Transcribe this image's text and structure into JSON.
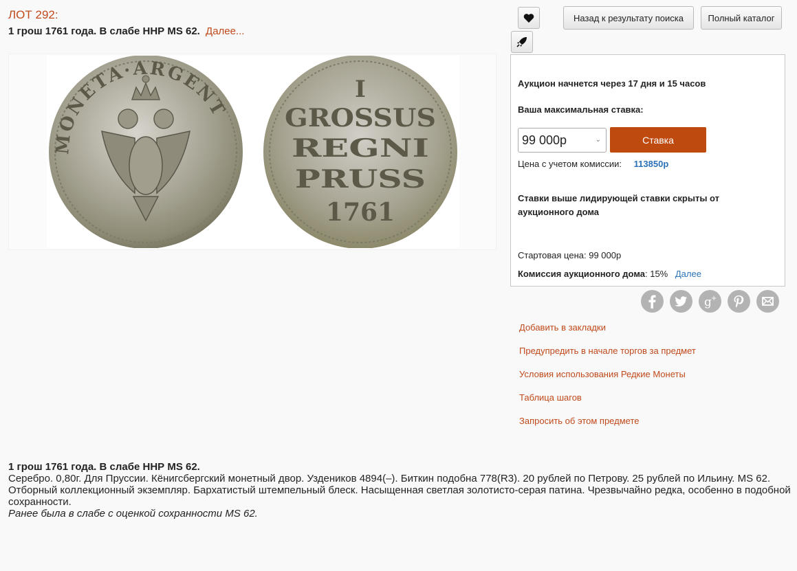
{
  "lot": {
    "number": "ЛОТ 292:",
    "title": "1 грош 1761 года. В слабе ННР MS 62.",
    "more_link": "Далее..."
  },
  "coin": {
    "obverse_legend": "MONETA·ARGENT",
    "reverse_lines": [
      "I",
      "GROSSUS",
      "REGNI",
      "PRUSS",
      "1761"
    ]
  },
  "toolbar": {
    "favorite_icon": "heart-icon",
    "rocket_icon": "rocket-icon",
    "back_label": "Назад к результату поиска",
    "catalog_label": "Полный каталог"
  },
  "bid": {
    "countdown": "Аукцион начнется через 17 дня и 15 часов",
    "max_bid_label": "Ваша максимальная ставка:",
    "selected_amount": "99 000р",
    "submit_label": "Ставка",
    "commission_label": "Цена с учетом комиссии:",
    "commission_value": "113850р",
    "hidden_note": "Ставки выше лидирующей ставки скрыты от аукционного дома",
    "start_price_label": "Стартовая цена: ",
    "start_price_value": "99 000р",
    "fee_label": "Комиссия аукционного дома",
    "fee_value": ": 15%",
    "fee_more": "Далее"
  },
  "social": [
    "facebook-icon",
    "twitter-icon",
    "google-plus-icon",
    "pinterest-icon",
    "email-icon"
  ],
  "links": [
    "Добавить в закладки",
    "Предупредить в начале торгов за предмет",
    "Условия использования Редкие Монеты",
    "Таблица шагов",
    "Запросить об этом предмете"
  ],
  "description": {
    "title": "1 грош 1761 года. В слабе ННР MS 62.",
    "line1": "Серебро. 0,80г. Для Пруссии. Кёнигсбергский монетный двор. Уздеников 4894(–). Биткин подобна 778(R3). 20 рублей по Петрову. 25 рублей по Ильину. MS 62.",
    "line2": "Отборный коллекционный экземпляр. Бархатистый штемпельный блеск. Насыщенная светлая золотисто-серая патина. Чрезвычайно редка, особенно в подобной сохранности.",
    "line3": "Ранее была в слабе с оценкой сохранности MS 62."
  }
}
